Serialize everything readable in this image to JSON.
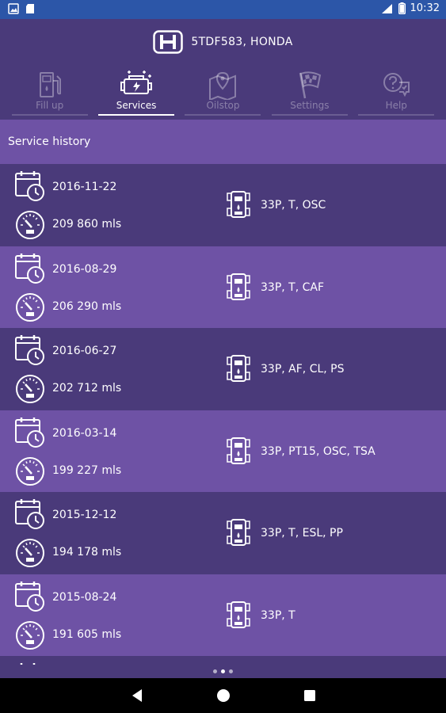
{
  "status_bar": {
    "time": "10:32"
  },
  "header": {
    "vehicle_title": "5TDF583,  HONDA"
  },
  "tabs": [
    {
      "label": "Fill up",
      "icon": "fuel-pump-icon",
      "active": false
    },
    {
      "label": "Services",
      "icon": "engine-icon",
      "active": true
    },
    {
      "label": "Oilstop",
      "icon": "map-pin-icon",
      "active": false
    },
    {
      "label": "Settings",
      "icon": "checkered-flag-icon",
      "active": false
    },
    {
      "label": "Help",
      "icon": "help-chat-icon",
      "active": false
    }
  ],
  "section": {
    "title": "Service history"
  },
  "history": [
    {
      "date": "2016-11-22",
      "mileage": "209 860 mls",
      "services": "33P,  T,  OSC"
    },
    {
      "date": "2016-08-29",
      "mileage": "206 290 mls",
      "services": "33P,  T,  CAF"
    },
    {
      "date": "2016-06-27",
      "mileage": "202 712 mls",
      "services": "33P,  AF,  CL,  PS"
    },
    {
      "date": "2016-03-14",
      "mileage": "199 227 mls",
      "services": "33P,  PT15,  OSC,  TSA"
    },
    {
      "date": "2015-12-12",
      "mileage": "194 178 mls",
      "services": "33P,  T,  ESL,  PP"
    },
    {
      "date": "2015-08-24",
      "mileage": "191 605 mls",
      "services": "33P,  T"
    }
  ],
  "colors": {
    "status_bar": "#2c56a8",
    "header": "#4a3a7a",
    "row_dark": "#4a3a7a",
    "row_light": "#6e52a5"
  }
}
